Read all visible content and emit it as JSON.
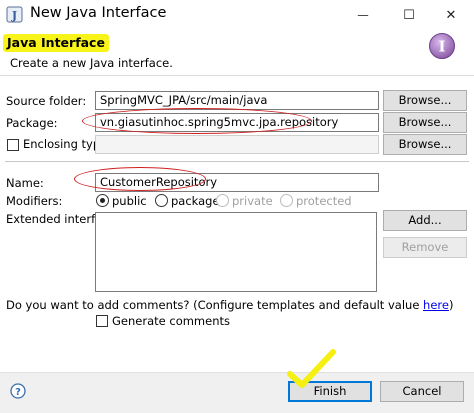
{
  "window": {
    "title": "New Java Interface",
    "minimize_glyph": "—",
    "maximize_glyph": "☐",
    "close_glyph": "✕"
  },
  "header": {
    "title": "Java Interface",
    "subtitle": "Create a new Java interface.",
    "icon": "interface-i-icon"
  },
  "source_folder": {
    "label": "Source folder:",
    "value": "SpringMVC_JPA/src/main/java",
    "browse_label": "Browse..."
  },
  "package": {
    "label": "Package:",
    "value": "vn.giasutinhoc.spring5mvc.jpa.repository",
    "browse_label": "Browse..."
  },
  "enclosing_type": {
    "label": "Enclosing type:",
    "checked": false,
    "value": "",
    "browse_label": "Browse..."
  },
  "name": {
    "label": "Name:",
    "value": "CustomerRepository"
  },
  "modifiers": {
    "label": "Modifiers:",
    "options": [
      {
        "label": "public",
        "selected": true,
        "enabled": true
      },
      {
        "label": "package",
        "selected": false,
        "enabled": true
      },
      {
        "label": "private",
        "selected": false,
        "enabled": false
      },
      {
        "label": "protected",
        "selected": false,
        "enabled": false
      }
    ]
  },
  "extended_interfaces": {
    "label": "Extended interfaces:",
    "add_label": "Add...",
    "remove_label": "Remove"
  },
  "comments": {
    "question": "Do you want to add comments? (Configure templates and default value ",
    "link": "here",
    "question_end": ")",
    "generate_label": "Generate comments",
    "generate_checked": false
  },
  "footer": {
    "help_glyph": "?",
    "finish_label": "Finish",
    "cancel_label": "Cancel"
  },
  "colors": {
    "highlight_yellow": "#f8f41a",
    "annotation_red": "#d02020",
    "focus_blue": "#0078d7",
    "header_icon_purple": "#8e5fa8"
  }
}
